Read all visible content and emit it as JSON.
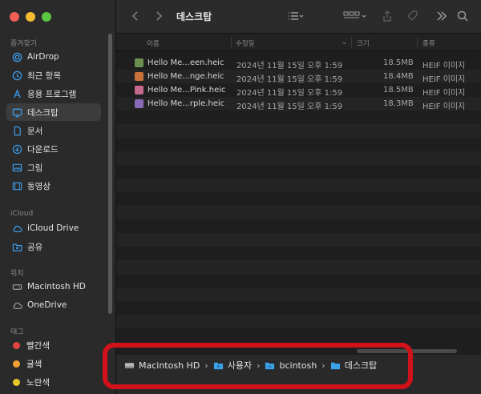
{
  "window": {
    "title": "데스크탑"
  },
  "sidebar": {
    "sections": {
      "favorites": "즐겨찾기",
      "icloud": "iCloud",
      "locations": "위치",
      "tags": "태그"
    },
    "favorites": [
      {
        "label": "AirDrop",
        "icon": "airdrop-icon"
      },
      {
        "label": "최근 항목",
        "icon": "clock-icon"
      },
      {
        "label": "응용 프로그램",
        "icon": "applications-icon"
      },
      {
        "label": "데스크탑",
        "icon": "desktop-icon",
        "selected": true
      },
      {
        "label": "문서",
        "icon": "document-icon"
      },
      {
        "label": "다운로드",
        "icon": "download-icon"
      },
      {
        "label": "그림",
        "icon": "photo-icon"
      },
      {
        "label": "동영상",
        "icon": "movie-icon"
      }
    ],
    "icloud": [
      {
        "label": "iCloud Drive",
        "icon": "cloud-icon"
      },
      {
        "label": "공유",
        "icon": "shared-folder-icon"
      }
    ],
    "locations": [
      {
        "label": "Macintosh HD",
        "icon": "disk-icon"
      },
      {
        "label": "OneDrive",
        "icon": "cloud-icon"
      }
    ],
    "tags": [
      {
        "label": "빨간색",
        "color": "#e0443e"
      },
      {
        "label": "귤색",
        "color": "#f0a030"
      },
      {
        "label": "노란색",
        "color": "#e8c728"
      }
    ]
  },
  "columns": {
    "name": "이름",
    "date": "수정일",
    "size": "크기",
    "kind": "종류"
  },
  "files": [
    {
      "name": "Hello Me...een.heic",
      "date": "2024년 11월 15일 오후 1:59",
      "size": "18.5MB",
      "kind": "HEIF 이미지",
      "thumb": "#6a8f4e"
    },
    {
      "name": "Hello Me...nge.heic",
      "date": "2024년 11월 15일 오후 1:59",
      "size": "18.4MB",
      "kind": "HEIF 이미지",
      "thumb": "#c9733a"
    },
    {
      "name": "Hello Me...Pink.heic",
      "date": "2024년 11월 15일 오후 1:59",
      "size": "18.5MB",
      "kind": "HEIF 이미지",
      "thumb": "#c56a8c"
    },
    {
      "name": "Hello Me...rple.heic",
      "date": "2024년 11월 15일 오후 1:59",
      "size": "18.3MB",
      "kind": "HEIF 이미지",
      "thumb": "#8a6ab8"
    }
  ],
  "pathbar": {
    "segments": [
      {
        "label": "Macintosh HD",
        "icon": "disk-icon"
      },
      {
        "label": "사용자",
        "icon": "folder-icon"
      },
      {
        "label": "bcintosh",
        "icon": "folder-icon"
      },
      {
        "label": "데스크탑",
        "icon": "folder-icon"
      }
    ]
  },
  "colors": {
    "highlight": "#d1121a",
    "folder_blue": "#3aa0e8"
  }
}
